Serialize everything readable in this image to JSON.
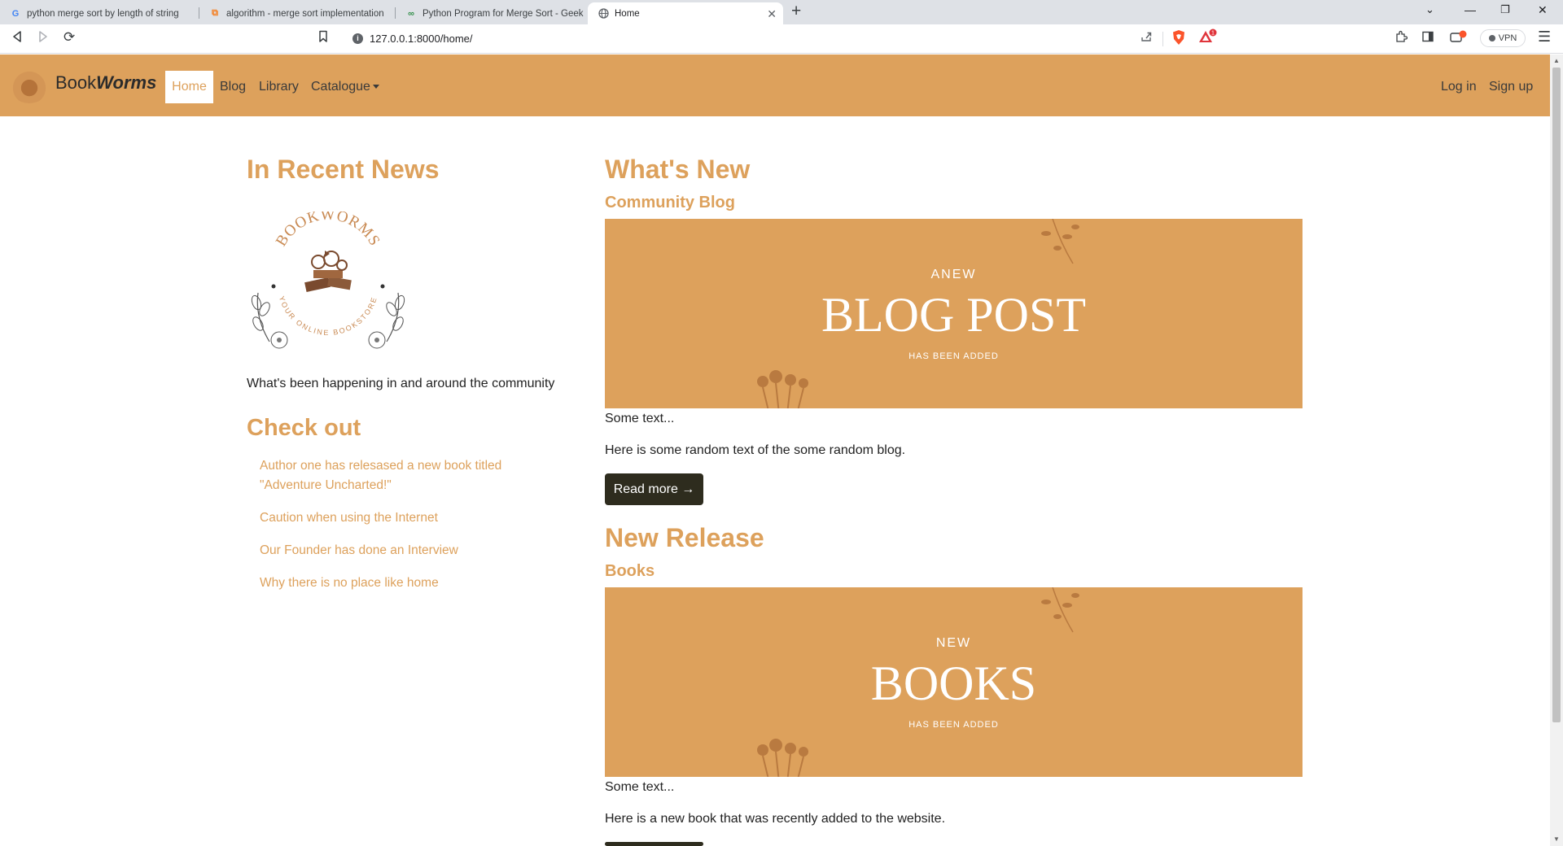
{
  "browser": {
    "tabs": [
      {
        "title": "python merge sort by length of string",
        "icon": "google-icon"
      },
      {
        "title": "algorithm - merge sort implementation",
        "icon": "stackoverflow-icon"
      },
      {
        "title": "Python Program for Merge Sort - Geek",
        "icon": "geeksforgeeks-icon"
      },
      {
        "title": "Home",
        "icon": "globe-icon"
      }
    ],
    "url": "127.0.0.1:8000/home/",
    "vpn_label": "VPN"
  },
  "navbar": {
    "brand_plain": "Book",
    "brand_bold": "Worms",
    "links": [
      "Home",
      "Blog",
      "Library",
      "Catalogue"
    ],
    "right_links": [
      "Log in",
      "Sign up"
    ],
    "bg": "#dda15c"
  },
  "sidebar": {
    "heading": "In Recent News",
    "logo_text_top": "BOOKWORMS",
    "logo_text_bottom": "YOUR ONLINE BOOKSTORE",
    "lede": "What's been happening in and around the community",
    "checkout_heading": "Check out",
    "news": [
      "Author one has relesased a new book titled \"Adventure Uncharted!\"",
      "Caution when using the Internet",
      "Our Founder has done an Interview",
      "Why there is no place like home"
    ]
  },
  "main": {
    "sections": [
      {
        "heading": "What's New",
        "subheading": "Community Blog",
        "banner": {
          "top": "ANEW",
          "main": "BLOG POST",
          "bottom": "HAS BEEN ADDED"
        },
        "text1": "Some text...",
        "text2": "Here is some random text of the some random blog.",
        "button": "Read more →"
      },
      {
        "heading": "New Release",
        "subheading": "Books",
        "banner": {
          "top": "NEW",
          "main": "BOOKS",
          "bottom": "HAS BEEN ADDED"
        },
        "text1": "Some text...",
        "text2": "Here is a new book that was recently added to the website."
      }
    ]
  }
}
